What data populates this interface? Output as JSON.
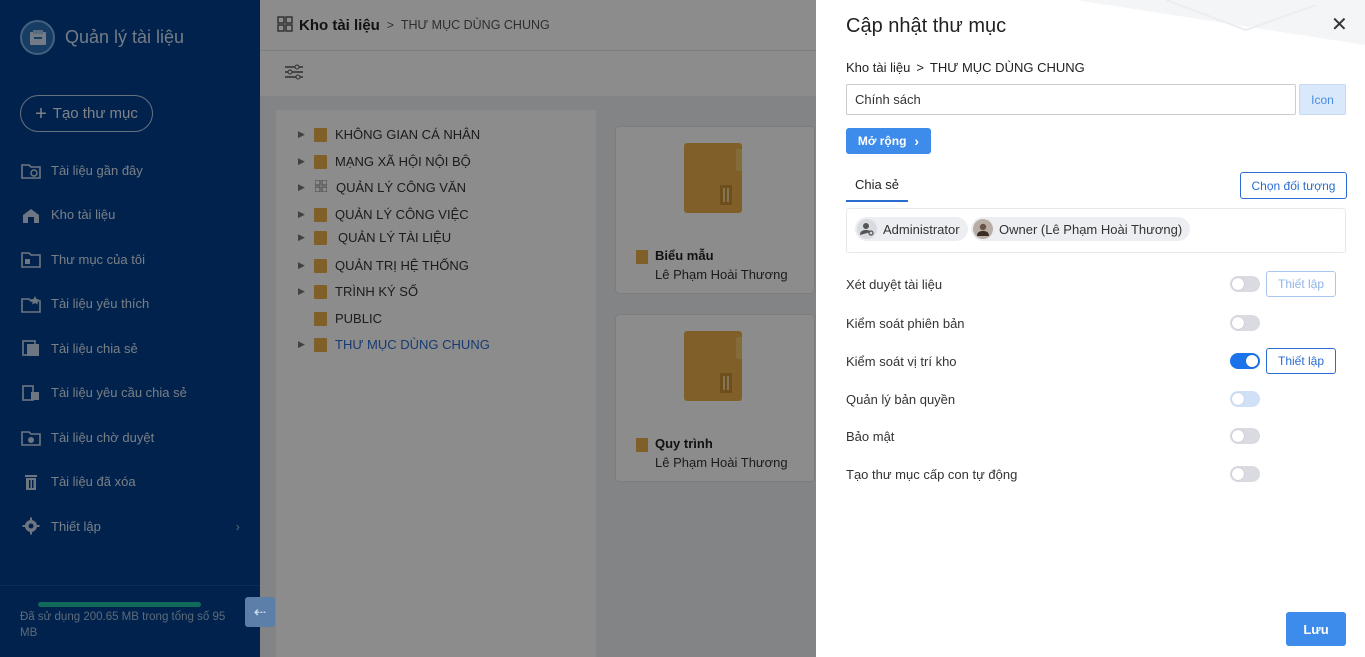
{
  "app": {
    "title": "Quản lý tài liệu",
    "new_folder_label": "Tạo thư mục"
  },
  "sidebar": {
    "items": [
      {
        "label": "Tài liệu gần đây",
        "icon": "recent-docs-icon"
      },
      {
        "label": "Kho tài liệu",
        "icon": "repository-icon"
      },
      {
        "label": "Thư mục của tôi",
        "icon": "my-folder-icon"
      },
      {
        "label": "Tài liệu yêu thích",
        "icon": "favorite-docs-icon"
      },
      {
        "label": "Tài liệu chia sẻ",
        "icon": "shared-docs-icon"
      },
      {
        "label": "Tài liệu yêu cầu chia sẻ",
        "icon": "share-request-icon"
      },
      {
        "label": "Tài liệu chờ duyệt",
        "icon": "pending-docs-icon"
      },
      {
        "label": "Tài liệu đã xóa",
        "icon": "trash-icon"
      },
      {
        "label": "Thiết lập",
        "icon": "gear-icon"
      }
    ],
    "storage_text": "Đã sử dụng 200.65 MB trong tổng số 95 MB",
    "storage_used_fraction": 1.0
  },
  "main": {
    "breadcrumb_root": "Kho tài liệu",
    "breadcrumb_current": "THƯ MỤC DÙNG CHUNG",
    "tree": [
      {
        "label": "KHÔNG GIAN CÁ NHÂN",
        "expandable": true,
        "icon": "folder-icon"
      },
      {
        "label": "MẠNG XÃ HỘI NỘI BỘ",
        "expandable": true,
        "icon": "folder-icon"
      },
      {
        "label": "QUẢN LÝ CÔNG VĂN",
        "expandable": true,
        "icon": "grid-icon"
      },
      {
        "label": "QUẢN LÝ CÔNG VIỆC",
        "expandable": true,
        "icon": "folder-icon"
      },
      {
        "label": "QUẢN LÝ TÀI LIỆU",
        "expandable": true,
        "icon": "folder-icon"
      },
      {
        "label": "QUẢN TRỊ HỆ THỐNG",
        "expandable": true,
        "icon": "folder-icon"
      },
      {
        "label": "TRÌNH KÝ SỐ",
        "expandable": true,
        "icon": "folder-icon"
      },
      {
        "label": "PUBLIC",
        "expandable": false,
        "icon": "folder-icon"
      },
      {
        "label": "THƯ MỤC DÙNG CHUNG",
        "expandable": true,
        "icon": "folder-icon",
        "active": true
      }
    ],
    "cards": [
      {
        "name": "Biểu mẫu",
        "owner": "Lê Phạm Hoài Thương"
      },
      {
        "name": "Quy trình",
        "owner": "Lê Phạm Hoài Thương"
      }
    ]
  },
  "drawer": {
    "title": "Cập nhật thư mục",
    "breadcrumb_root": "Kho tài liệu",
    "breadcrumb_current": "THƯ MỤC DÙNG CHUNG",
    "name_value": "Chính sách",
    "icon_label": "Icon",
    "expand_label": "Mở rộng",
    "tab_share": "Chia sẻ",
    "choose_label": "Chọn đối tượng",
    "chips": [
      {
        "label": "Administrator"
      },
      {
        "label": "Owner (Lê Phạm Hoài Thương)"
      }
    ],
    "settings": [
      {
        "label": "Xét duyệt tài liệu",
        "on": false,
        "setup": "Thiết lập",
        "setup_enabled": false
      },
      {
        "label": "Kiểm soát phiên bản",
        "on": false
      },
      {
        "label": "Kiểm soát vị trí kho",
        "on": true,
        "setup": "Thiết lập",
        "setup_enabled": true
      },
      {
        "label": "Quản lý bản quyền",
        "on": false
      },
      {
        "label": "Bảo mật",
        "on": false
      },
      {
        "label": "Tạo thư mục cấp con tự động",
        "on": false
      }
    ],
    "save_label": "Lưu"
  },
  "colors": {
    "sidebar_bg": "#003f8a",
    "accent": "#2b6cd0",
    "primary_button": "#3d8bea",
    "folder": "#e9b04a",
    "storage_fill": "#1fbfa3"
  }
}
